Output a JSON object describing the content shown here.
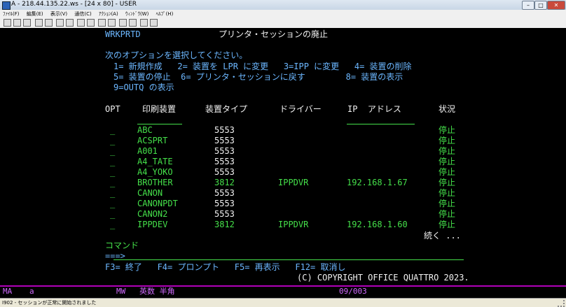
{
  "window": {
    "title": "A - 218.44.135.22.ws - [24 x 80] - USER",
    "min": "–",
    "max": "□",
    "close": "✕"
  },
  "menu": [
    "ﾌｧｲﾙ(F)",
    "編集(E)",
    "表示(V)",
    "通信(C)",
    "ｱｸｼｮﾝ(A)",
    "ｳｨﾝﾄﾞｳ(W)",
    "ﾍﾙﾌﾟ(H)"
  ],
  "screen": {
    "program": "WRKPRTD",
    "title": "プリンタ・セッションの廃止",
    "instruction": "次のオプションを選択してください。",
    "options_line1": "1= 新規作成   2= 装置を LPR に変更   3=IPP に変更   4= 装置の削除",
    "options_line2": "5= 装置の停止  6= プリンタ・セッションに戻す        8= 装置の表示",
    "options_line3": "9=OUTQ の表示",
    "headers": {
      "opt": "OPT",
      "device": "印刷装置",
      "type": "装置タイプ",
      "driver": "ドライバー",
      "ip": "IP  アドレス",
      "status": "状況"
    },
    "rows": [
      {
        "name": "ABC",
        "type": "5553",
        "driver": "",
        "ip": "",
        "status": "停止"
      },
      {
        "name": "ACSPRT",
        "type": "5553",
        "driver": "",
        "ip": "",
        "status": "停止"
      },
      {
        "name": "A001",
        "type": "5553",
        "driver": "",
        "ip": "",
        "status": "停止"
      },
      {
        "name": "A4_TATE",
        "type": "5553",
        "driver": "",
        "ip": "",
        "status": "停止"
      },
      {
        "name": "A4_YOKO",
        "type": "5553",
        "driver": "",
        "ip": "",
        "status": "停止"
      },
      {
        "name": "BROTHER",
        "type": "3812",
        "driver": "IPPDVR",
        "ip": "192.168.1.67",
        "status": "停止"
      },
      {
        "name": "CANON",
        "type": "5553",
        "driver": "",
        "ip": "",
        "status": "停止"
      },
      {
        "name": "CANONPDT",
        "type": "5553",
        "driver": "",
        "ip": "",
        "status": "停止"
      },
      {
        "name": "CANON2",
        "type": "5553",
        "driver": "",
        "ip": "",
        "status": "停止"
      },
      {
        "name": "IPPDEV",
        "type": "3812",
        "driver": "IPPDVR",
        "ip": "192.168.1.60",
        "status": "停止"
      }
    ],
    "more": "続く ...",
    "command_label": "コマンド",
    "prompt": "===>",
    "fkeys": "F3= 終了   F4= プロンプト   F5= 再表示   F12= 取消し",
    "copyright": "(C) COPYRIGHT OFFICE QUATTRO 2023."
  },
  "oia": {
    "ma": "MA",
    "a": "a",
    "mw": "MW",
    "mode": "英数 半角",
    "position": "09/003"
  },
  "status_bar": {
    "message": "I902 - セッションが正常に開始されました"
  }
}
